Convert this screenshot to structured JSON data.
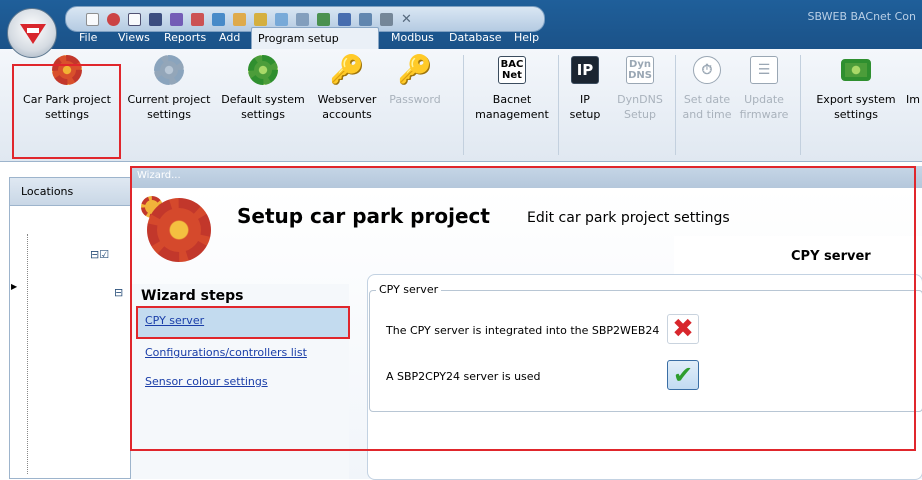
{
  "app": {
    "title": "SBWEB BACnet Con"
  },
  "menu_tabs": [
    "File",
    "Views",
    "Reports",
    "Add",
    "Program setup",
    "Modbus",
    "Database",
    "Help"
  ],
  "active_tab": "Program setup",
  "ribbon": {
    "buttons": [
      {
        "line1": "Car Park project",
        "line2": "settings",
        "icon": "gear-icon",
        "enabled": true
      },
      {
        "line1": "Current project",
        "line2": "settings",
        "icon": "gear-icon",
        "enabled": true
      },
      {
        "line1": "Default system",
        "line2": "settings",
        "icon": "gear-icon",
        "enabled": true
      },
      {
        "line1": "Webserver",
        "line2": "accounts",
        "icon": "key-icon",
        "enabled": true
      },
      {
        "line1": "Password",
        "line2": "",
        "icon": "key-icon",
        "enabled": false
      },
      {
        "line1": "Bacnet",
        "line2": "management",
        "icon": "bacnet-icon",
        "icon_text": "BAC Net",
        "enabled": true
      },
      {
        "line1": "IP",
        "line2": "setup",
        "icon": "ip-icon",
        "icon_text": "IP",
        "enabled": true
      },
      {
        "line1": "DynDNS",
        "line2": "Setup",
        "icon": "dyndns-icon",
        "icon_text": "Dyn DNS",
        "enabled": false
      },
      {
        "line1": "Set date",
        "line2": "and time",
        "icon": "clock-icon",
        "enabled": false
      },
      {
        "line1": "Update",
        "line2": "firmware",
        "icon": "firmware-icon",
        "enabled": false
      },
      {
        "line1": "Export system",
        "line2": "settings",
        "icon": "export-icon",
        "enabled": true
      },
      {
        "line1": "Im",
        "line2": "",
        "icon": "import-icon",
        "enabled": true
      }
    ]
  },
  "left_panel": {
    "title": "Locations"
  },
  "wizard": {
    "window_title": "Wizard...",
    "heading": "Setup car park project",
    "subheading": "Edit car park project settings",
    "steps_title": "Wizard steps",
    "steps": [
      "CPY server",
      "Configurations/controllers list",
      "Sensor colour settings"
    ],
    "selected_step": "CPY server",
    "tab_title": "CPY server",
    "group_title": "CPY server",
    "options": [
      {
        "label": "The CPY server is integrated into the SBP2WEB24",
        "state": "not-selected",
        "icon": "red-x-icon"
      },
      {
        "label": "A SBP2CPY24 server is used",
        "state": "selected",
        "icon": "green-check-icon"
      }
    ]
  },
  "colors": {
    "title_bar": "#1f5f9a",
    "annotation_red": "#e0262c",
    "link_blue": "#1a3ea8",
    "selected_step_bg": "#c3dbef"
  }
}
